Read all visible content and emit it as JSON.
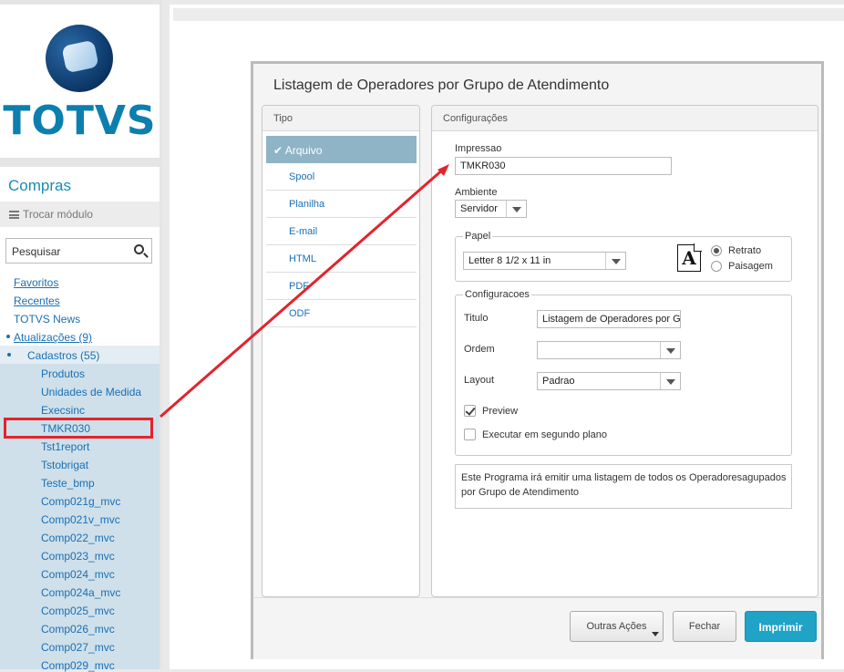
{
  "brand": {
    "logo_text": "TOTVS"
  },
  "sidebar": {
    "module_title": "Compras",
    "switch_module": "Trocar módulo",
    "search_placeholder": "Pesquisar",
    "links": [
      "Favoritos",
      "Recentes",
      "TOTVS News",
      "Atualizações (9)",
      "Cadastros (55)"
    ],
    "sub_items": [
      "Produtos",
      "Unidades de Medida",
      "Execsinc",
      "TMKR030",
      "Tst1report",
      "Tstobrigat",
      "Teste_bmp",
      "Comp021g_mvc",
      "Comp021v_mvc",
      "Comp022_mvc",
      "Comp023_mvc",
      "Comp024_mvc",
      "Comp024a_mvc",
      "Comp025_mvc",
      "Comp026_mvc",
      "Comp027_mvc",
      "Comp029_mvc"
    ]
  },
  "dialog": {
    "title": "Listagem de Operadores por Grupo de Atendimento",
    "tipo_header": "Tipo",
    "tipo_items": [
      "Arquivo",
      "Spool",
      "Planilha",
      "E-mail",
      "HTML",
      "PDF",
      "ODF"
    ],
    "tipo_selected_check": "✔",
    "config_header": "Configurações",
    "impressao_label": "Impressao",
    "impressao_value": "TMKR030",
    "ambiente_label": "Ambiente",
    "ambiente_value": "Servidor",
    "papel_label": "Papel",
    "papel_value": "Letter 8 1/2 x 11 in",
    "paper_icon_letter": "A",
    "orientation": [
      "Retrato",
      "Paisagem"
    ],
    "configuracoes_label": "Configuracoes",
    "titulo_label": "Titulo",
    "titulo_value": "Listagem de Operadores por G",
    "ordem_label": "Ordem",
    "ordem_value": "",
    "layout_label": "Layout",
    "layout_value": "Padrao",
    "preview_label": "Preview",
    "background_label": "Executar em segundo plano",
    "description_line1": "Este Programa irá emitir uma listagem de todos os Operadoresagupados",
    "description_line2": "por Grupo de Atendimento",
    "buttons": {
      "more": "Outras Ações",
      "close": "Fechar",
      "print": "Imprimir"
    }
  },
  "colors": {
    "accent": "#1fa3c6",
    "link": "#1a6fb5",
    "highlight": "#e3232b",
    "selected_tipo": "#8fb4c6"
  }
}
